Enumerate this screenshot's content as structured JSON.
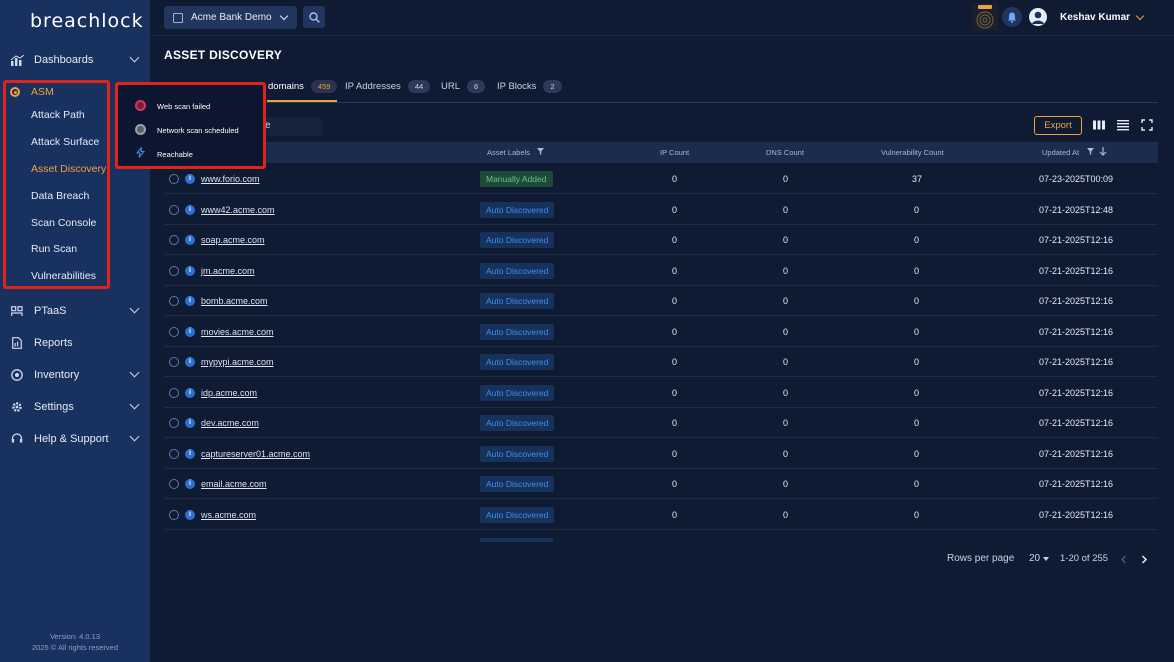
{
  "app": {
    "logo": "breachlock",
    "version": "Version: 4.0.13",
    "copyright": "2025 © All rights reserved"
  },
  "sidebar": {
    "dashboards": "Dashboards",
    "asm": "ASM",
    "asm_items": [
      "Attack Path",
      "Attack Surface",
      "Asset Discovery",
      "Data Breach",
      "Scan Console",
      "Run Scan",
      "Vulnerabilities"
    ],
    "active_item": "Asset Discovery",
    "ptaas": "PTaaS",
    "reports": "Reports",
    "inventory": "Inventory",
    "settings": "Settings",
    "help": "Help & Support"
  },
  "header": {
    "org": "Acme Bank Demo",
    "user": "Keshav Kumar"
  },
  "page": {
    "title": "ASSET DISCOVERY"
  },
  "tabs": [
    {
      "label": "domains",
      "count": "459"
    },
    {
      "label": "IP Addresses",
      "count": "44"
    },
    {
      "label": "URL",
      "count": "6"
    },
    {
      "label": "IP Blocks",
      "count": "2"
    }
  ],
  "toolbar": {
    "filter_value": "ve",
    "export_label": "Export"
  },
  "table": {
    "columns": [
      "Asset Labels",
      "IP Count",
      "DNS Count",
      "Vulnerability Count",
      "Updated At"
    ],
    "rows": [
      {
        "name": "www.forio.com",
        "label": "Manually Added",
        "ip": "0",
        "dns": "0",
        "vuln": "37",
        "updated": "07-23-2025T00:09"
      },
      {
        "name": "www42.acme.com",
        "label": "Auto Discovered",
        "ip": "0",
        "dns": "0",
        "vuln": "0",
        "updated": "07-21-2025T12:48"
      },
      {
        "name": "soap.acme.com",
        "label": "Auto Discovered",
        "ip": "0",
        "dns": "0",
        "vuln": "0",
        "updated": "07-21-2025T12:16"
      },
      {
        "name": "jm.acme.com",
        "label": "Auto Discovered",
        "ip": "0",
        "dns": "0",
        "vuln": "0",
        "updated": "07-21-2025T12:16"
      },
      {
        "name": "bomb.acme.com",
        "label": "Auto Discovered",
        "ip": "0",
        "dns": "0",
        "vuln": "0",
        "updated": "07-21-2025T12:16"
      },
      {
        "name": "movies.acme.com",
        "label": "Auto Discovered",
        "ip": "0",
        "dns": "0",
        "vuln": "0",
        "updated": "07-21-2025T12:16"
      },
      {
        "name": "mypypi.acme.com",
        "label": "Auto Discovered",
        "ip": "0",
        "dns": "0",
        "vuln": "0",
        "updated": "07-21-2025T12:16"
      },
      {
        "name": "idp.acme.com",
        "label": "Auto Discovered",
        "ip": "0",
        "dns": "0",
        "vuln": "0",
        "updated": "07-21-2025T12:16"
      },
      {
        "name": "dev.acme.com",
        "label": "Auto Discovered",
        "ip": "0",
        "dns": "0",
        "vuln": "0",
        "updated": "07-21-2025T12:16"
      },
      {
        "name": "captureserver01.acme.com",
        "label": "Auto Discovered",
        "ip": "0",
        "dns": "0",
        "vuln": "0",
        "updated": "07-21-2025T12:16"
      },
      {
        "name": "email.acme.com",
        "label": "Auto Discovered",
        "ip": "0",
        "dns": "0",
        "vuln": "0",
        "updated": "07-21-2025T12:16"
      },
      {
        "name": "ws.acme.com",
        "label": "Auto Discovered",
        "ip": "0",
        "dns": "0",
        "vuln": "0",
        "updated": "07-21-2025T12:16"
      }
    ]
  },
  "pagination": {
    "rows_per_page_label": "Rows per page",
    "rows_per_page": "20",
    "range": "1-20 of 255"
  },
  "legend_popup": {
    "items": [
      "Web scan failed",
      "Network scan scheduled",
      "Reachable"
    ]
  },
  "colors": {
    "accent": "#f0a23c",
    "sidebar": "#18315f",
    "background": "#0f1a33",
    "highlight_box": "#e0241a"
  }
}
